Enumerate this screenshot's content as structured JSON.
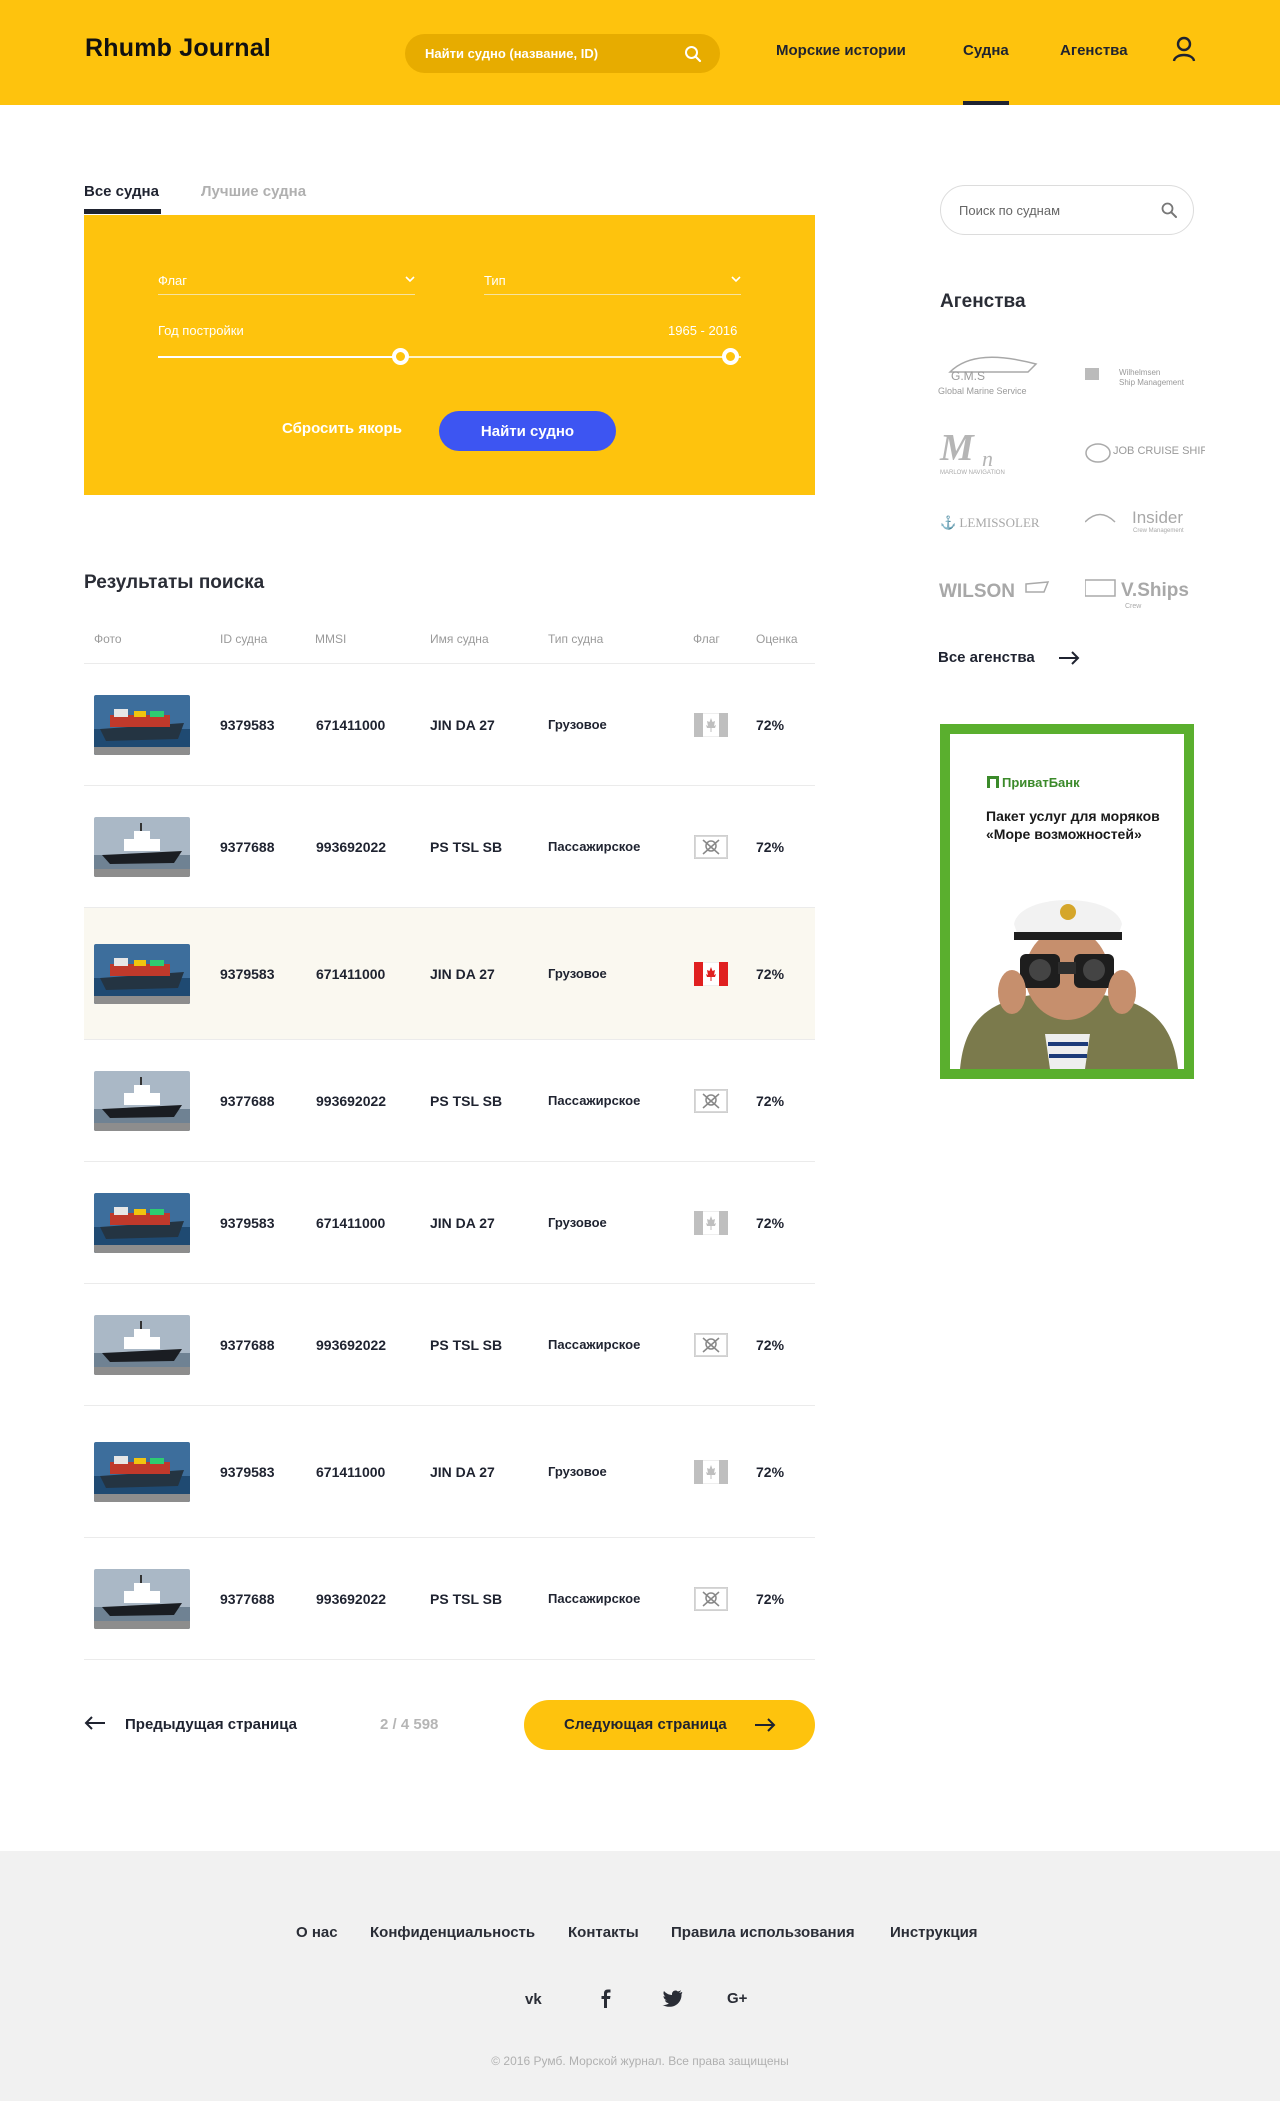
{
  "header": {
    "logo": "Rhumb Journal",
    "search_placeholder": "Найти судно (название, ID)",
    "nav": [
      "Морские истории",
      "Судна",
      "Агенства"
    ],
    "active_nav": "Судна"
  },
  "tabs": {
    "all": "Все судна",
    "best": "Лучшие судна"
  },
  "filter": {
    "flag_label": "Флаг",
    "type_label": "Тип",
    "year_label": "Год постройки",
    "year_range": "1965 - 2016",
    "reset_label": "Сбросить якорь",
    "find_label": "Найти судно"
  },
  "results": {
    "title": "Результаты поиска",
    "columns": [
      "Фото",
      "ID судна",
      "MMSI",
      "Имя судна",
      "Тип судна",
      "Флаг",
      "Оценка"
    ],
    "rows": [
      {
        "id": "9379583",
        "mmsi": "671411000",
        "name": "JIN DA 27",
        "type": "Грузовое",
        "flag": "canada",
        "score": "72%"
      },
      {
        "id": "9377688",
        "mmsi": "993692022",
        "name": "PS TSL SB",
        "type": "Пассажирское",
        "flag": "skull",
        "score": "72%"
      },
      {
        "id": "9379583",
        "mmsi": "671411000",
        "name": "JIN DA 27",
        "type": "Грузовое",
        "flag": "canada",
        "score": "72%"
      },
      {
        "id": "9377688",
        "mmsi": "993692022",
        "name": "PS TSL SB",
        "type": "Пассажирское",
        "flag": "skull",
        "score": "72%"
      },
      {
        "id": "9379583",
        "mmsi": "671411000",
        "name": "JIN DA 27",
        "type": "Грузовое",
        "flag": "canada",
        "score": "72%"
      },
      {
        "id": "9377688",
        "mmsi": "993692022",
        "name": "PS TSL SB",
        "type": "Пассажирское",
        "flag": "skull",
        "score": "72%"
      },
      {
        "id": "9379583",
        "mmsi": "671411000",
        "name": "JIN DA 27",
        "type": "Грузовое",
        "flag": "canada",
        "score": "72%"
      },
      {
        "id": "9377688",
        "mmsi": "993692022",
        "name": "PS TSL SB",
        "type": "Пассажирское",
        "flag": "skull",
        "score": "72%"
      }
    ]
  },
  "pagination": {
    "prev_label": "Предыдущая страница",
    "pages": "2 / 4 598",
    "next_label": "Следующая страница"
  },
  "sidebar": {
    "search_placeholder": "Поиск по суднам",
    "agencies_title": "Агенства",
    "agencies": [
      "G.M.S Global Marine Service",
      "Wilhelmsen Ship Management",
      "MN Marlow Navigation",
      "Job Cruise Ship",
      "Lemissoler",
      "Insider Crew Management",
      "Wilson",
      "V.Ships Crew"
    ],
    "all_agencies": "Все агенства"
  },
  "ad": {
    "bank": "ПриватБанк",
    "text": "Пакет услуг для моряков «Море возможностей»"
  },
  "footer": {
    "links": [
      "О нас",
      "Конфиденциальность",
      "Контакты",
      "Правила использования",
      "Инструкция"
    ],
    "social": [
      "vk-icon",
      "facebook-icon",
      "twitter-icon",
      "google-plus-icon"
    ],
    "copyright": "© 2016 Румб. Морской журнал. Все права защищены"
  },
  "colors": {
    "accent": "#fec30d",
    "button_blue": "#3d55f2",
    "ad_green": "#5aaf2e"
  }
}
